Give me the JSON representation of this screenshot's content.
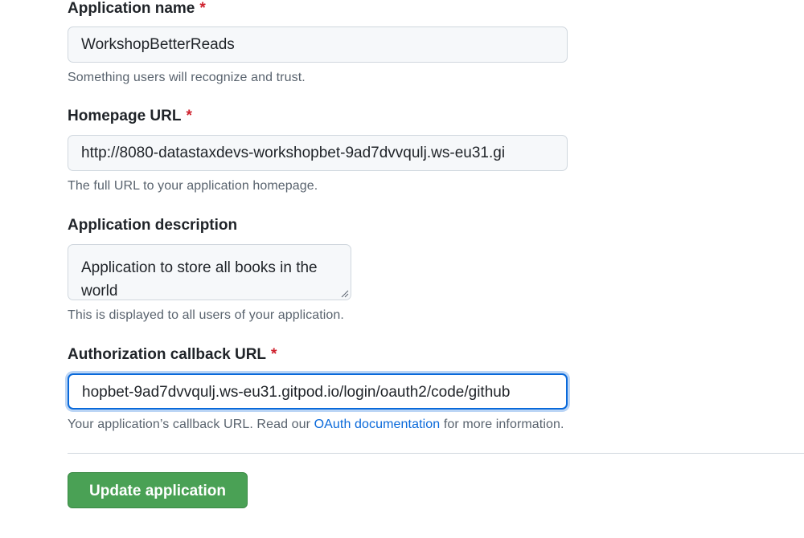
{
  "form": {
    "app_name": {
      "label": "Application name",
      "required_mark": "*",
      "value": "WorkshopBetterReads",
      "hint": "Something users will recognize and trust."
    },
    "homepage_url": {
      "label": "Homepage URL",
      "required_mark": "*",
      "value": "http://8080-datastaxdevs-workshopbet-9ad7dvvqulj.ws-eu31.gi",
      "hint": "The full URL to your application homepage."
    },
    "description": {
      "label": "Application description",
      "value": "Application to store all books in the world",
      "hint": "This is displayed to all users of your application."
    },
    "callback_url": {
      "label": "Authorization callback URL",
      "required_mark": "*",
      "value": "hopbet-9ad7dvvqulj.ws-eu31.gitpod.io/login/oauth2/code/github",
      "hint_prefix": "Your application’s callback URL. Read our ",
      "hint_link": "OAuth documentation",
      "hint_suffix": " for more information."
    },
    "submit_label": "Update application"
  },
  "colors": {
    "accent_blue": "#0969da",
    "required_red": "#cf222e",
    "button_green": "#4aa155"
  }
}
